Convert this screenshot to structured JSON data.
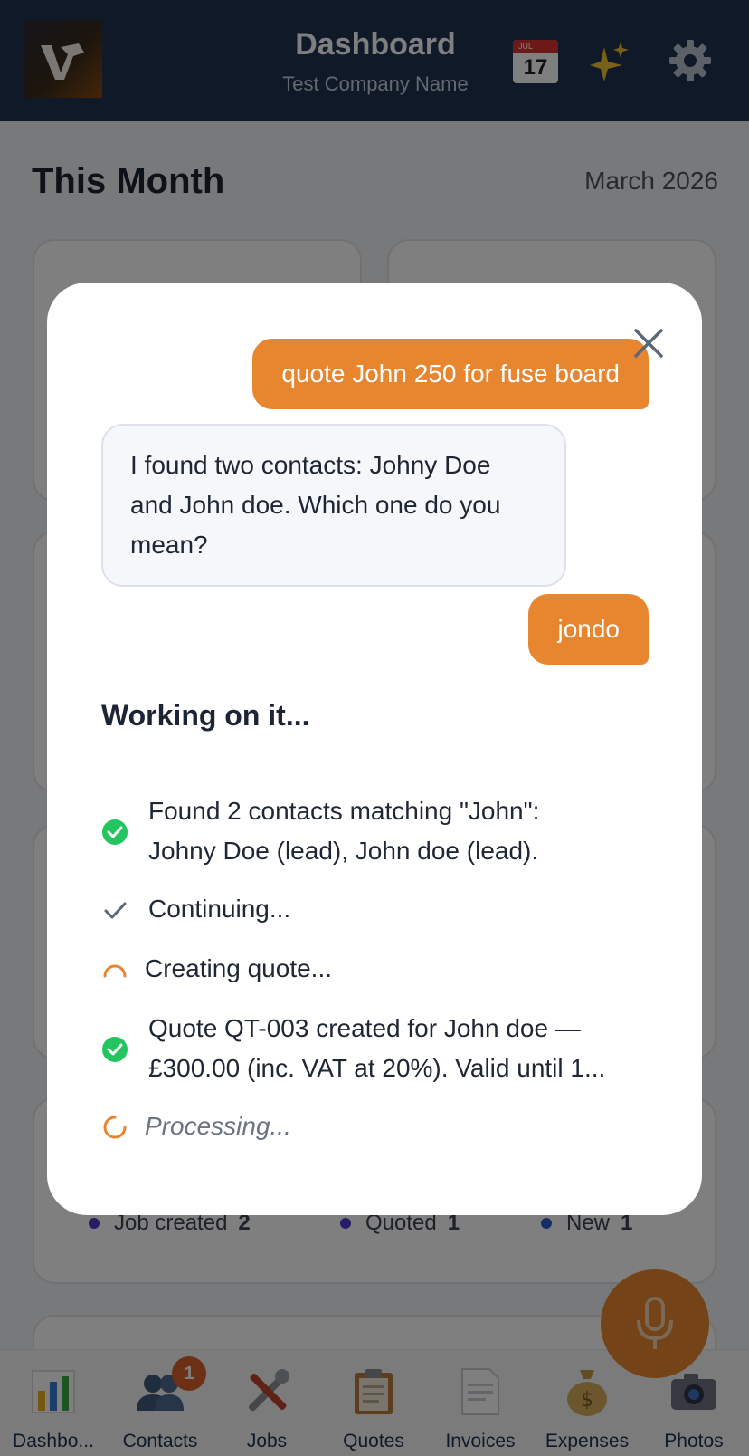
{
  "header": {
    "title": "Dashboard",
    "subtitle": "Test Company Name",
    "calendar": {
      "month": "JUL",
      "day": "17"
    },
    "icons": [
      "calendar-icon",
      "sparkle-icon",
      "gear-icon"
    ]
  },
  "main": {
    "section_title": "This Month",
    "period": "March 2026",
    "legend": [
      {
        "label": "Job created",
        "count": "2"
      },
      {
        "label": "Quoted",
        "count": "1"
      },
      {
        "label": "New",
        "count": "1"
      }
    ]
  },
  "nav": {
    "items": [
      {
        "label": "Dashbo...",
        "icon": "chart-icon"
      },
      {
        "label": "Contacts",
        "icon": "people-icon",
        "badge": "1"
      },
      {
        "label": "Jobs",
        "icon": "tools-icon"
      },
      {
        "label": "Quotes",
        "icon": "clipboard-icon"
      },
      {
        "label": "Invoices",
        "icon": "invoice-icon"
      },
      {
        "label": "Expenses",
        "icon": "money-bag-icon"
      },
      {
        "label": "Photos",
        "icon": "camera-icon"
      }
    ]
  },
  "chat": {
    "messages": [
      {
        "role": "user",
        "text": "quote John 250 for fuse board"
      },
      {
        "role": "assistant",
        "text": "I found two contacts: Johny Doe and John doe. Which one do you mean?"
      },
      {
        "role": "user",
        "text": "jondo"
      }
    ],
    "status_heading": "Working on it...",
    "steps": [
      {
        "state": "done",
        "line1": "Found 2 contacts matching \"John\":",
        "line2": "Johny Doe (lead), John doe (lead)."
      },
      {
        "state": "check",
        "line1": "Continuing..."
      },
      {
        "state": "in-progress",
        "line1": "Creating quote..."
      },
      {
        "state": "done",
        "line1": "Quote QT-003 created for John doe —",
        "line2": "£300.00 (inc. VAT at 20%). Valid until 1..."
      },
      {
        "state": "loading",
        "line1": "Processing..."
      }
    ]
  },
  "colors": {
    "header_bg": "#1e3350",
    "accent": "#e8862f",
    "success": "#22c55e",
    "badge": "#d9602a"
  }
}
